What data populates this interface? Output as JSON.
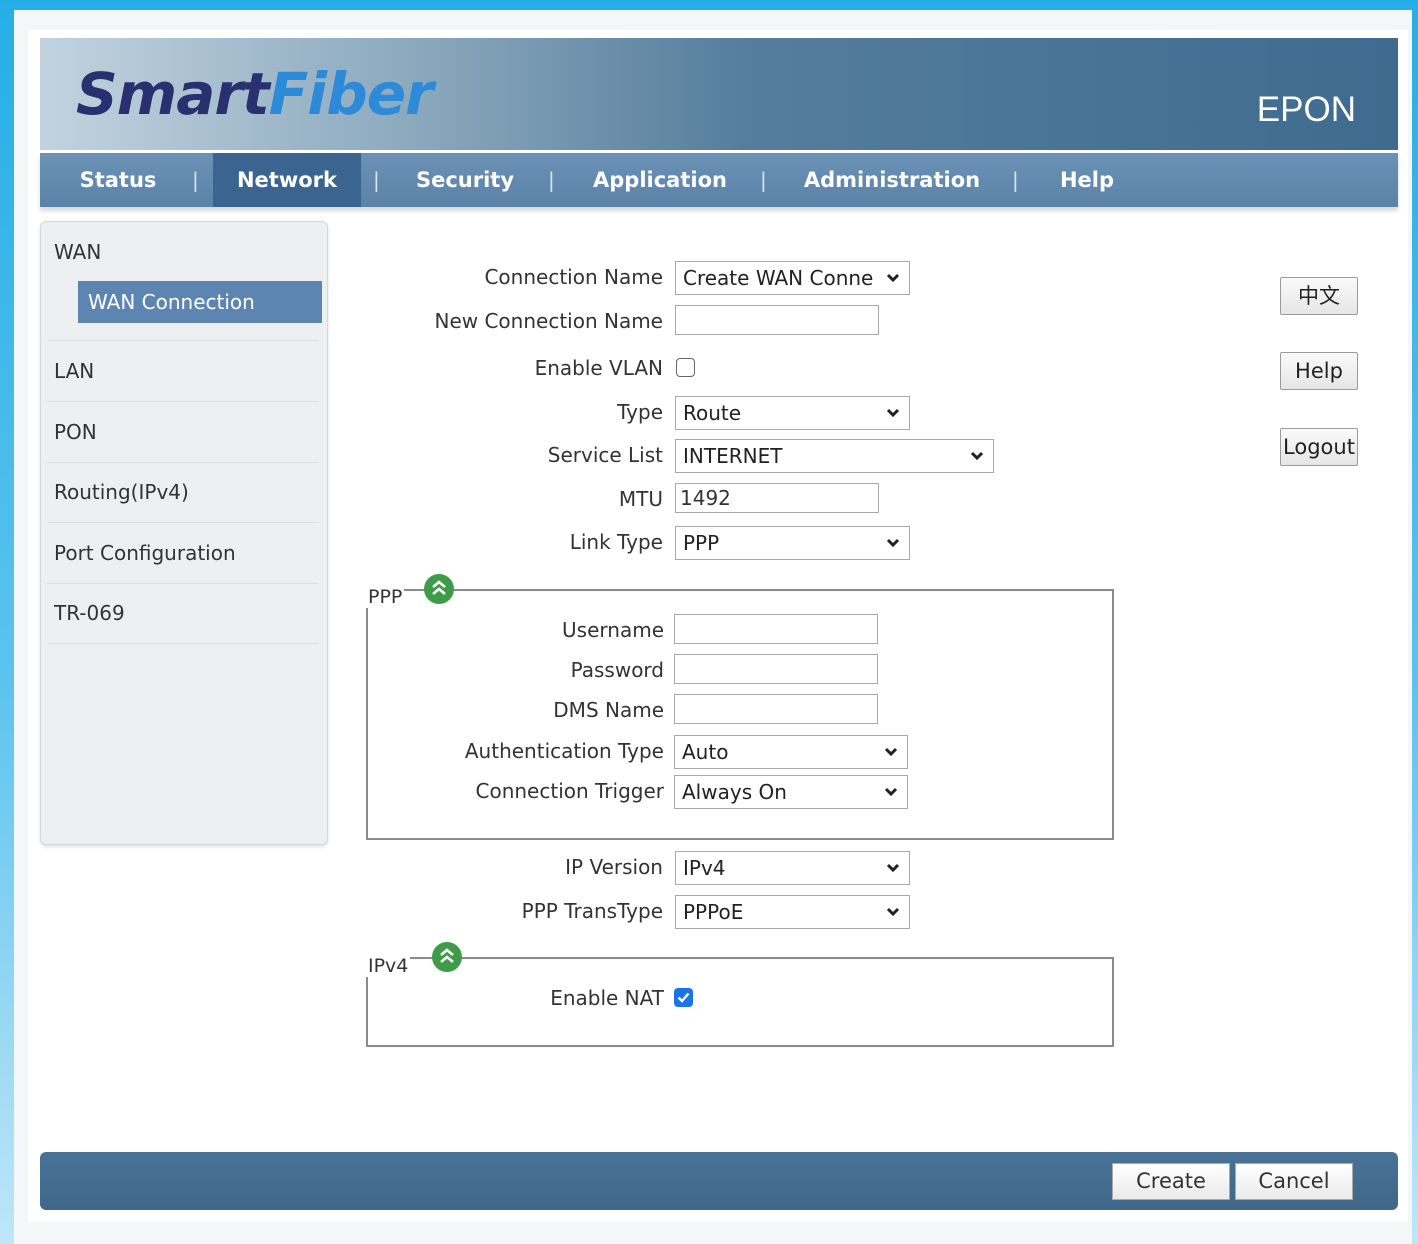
{
  "header": {
    "logo_smart": "Smart",
    "logo_fiber": "Fiber",
    "product": "EPON"
  },
  "nav": {
    "items": [
      "Status",
      "Network",
      "Security",
      "Application",
      "Administration",
      "Help"
    ],
    "active": "Network",
    "separator": "|"
  },
  "sidebar": {
    "wan": "WAN",
    "wan_connection": "WAN Connection",
    "lan": "LAN",
    "pon": "PON",
    "routing": "Routing(IPv4)",
    "port_config": "Port Configuration",
    "tr069": "TR-069"
  },
  "form": {
    "connection_name_label": "Connection Name",
    "connection_name_value": "Create WAN Conne",
    "new_connection_name_label": "New Connection Name",
    "new_connection_name_value": "",
    "enable_vlan_label": "Enable VLAN",
    "enable_vlan_checked": false,
    "type_label": "Type",
    "type_value": "Route",
    "service_list_label": "Service List",
    "service_list_value": "INTERNET",
    "mtu_label": "MTU",
    "mtu_value": "1492",
    "link_type_label": "Link Type",
    "link_type_value": "PPP",
    "ip_version_label": "IP Version",
    "ip_version_value": "IPv4",
    "ppp_transtype_label": "PPP TransType",
    "ppp_transtype_value": "PPPoE"
  },
  "ppp": {
    "legend": "PPP",
    "username_label": "Username",
    "password_label": "Password",
    "dms_name_label": "DMS Name",
    "auth_type_label": "Authentication Type",
    "auth_type_value": "Auto",
    "conn_trigger_label": "Connection Trigger",
    "conn_trigger_value": "Always On"
  },
  "ipv4": {
    "legend": "IPv4",
    "enable_nat_label": "Enable NAT",
    "enable_nat_checked": true
  },
  "right_buttons": {
    "language": "中文",
    "help": "Help",
    "logout": "Logout"
  },
  "footer": {
    "create": "Create",
    "cancel": "Cancel"
  },
  "colors": {
    "nav_bg": "#5b82a8",
    "nav_active": "#3b6490",
    "accent_green": "#3e9c48",
    "checkbox_blue": "#1a73e8"
  }
}
